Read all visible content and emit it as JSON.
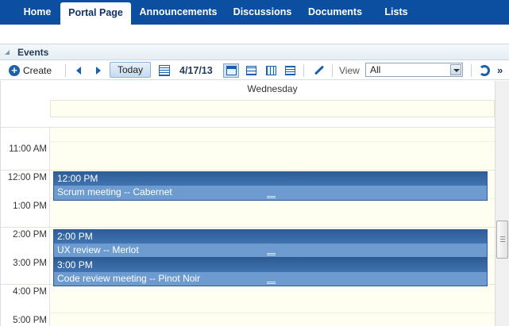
{
  "nav": {
    "tabs": [
      {
        "label": "Home"
      },
      {
        "label": "Portal Page",
        "active": true
      },
      {
        "label": "Announcements"
      },
      {
        "label": "Discussions"
      },
      {
        "label": "Documents"
      },
      {
        "label": "Lists"
      }
    ]
  },
  "panel": {
    "title": "Events"
  },
  "toolbar": {
    "create_label": "Create",
    "today_label": "Today",
    "date": "4/17/13",
    "view_label": "View",
    "view_value": "All",
    "more_label": "»"
  },
  "calendar": {
    "day_header": "Wednesday",
    "times": [
      "11:00 AM",
      "12:00 PM",
      "1:00 PM",
      "2:00 PM",
      "3:00 PM",
      "4:00 PM",
      "5:00 PM"
    ],
    "events": [
      {
        "time": "12:00 PM",
        "title": "Scrum meeting -- Cabernet"
      },
      {
        "time": "2:00 PM",
        "title": "UX review -- Merlot"
      },
      {
        "time": "3:00 PM",
        "title": "Code review meeting -- Pinot Noir"
      }
    ]
  },
  "colors": {
    "nav_bg": "#0c4fa0",
    "event_header": "#2f5e97",
    "event_body": "#6d9bd0",
    "day_bg": "#fefff0"
  }
}
